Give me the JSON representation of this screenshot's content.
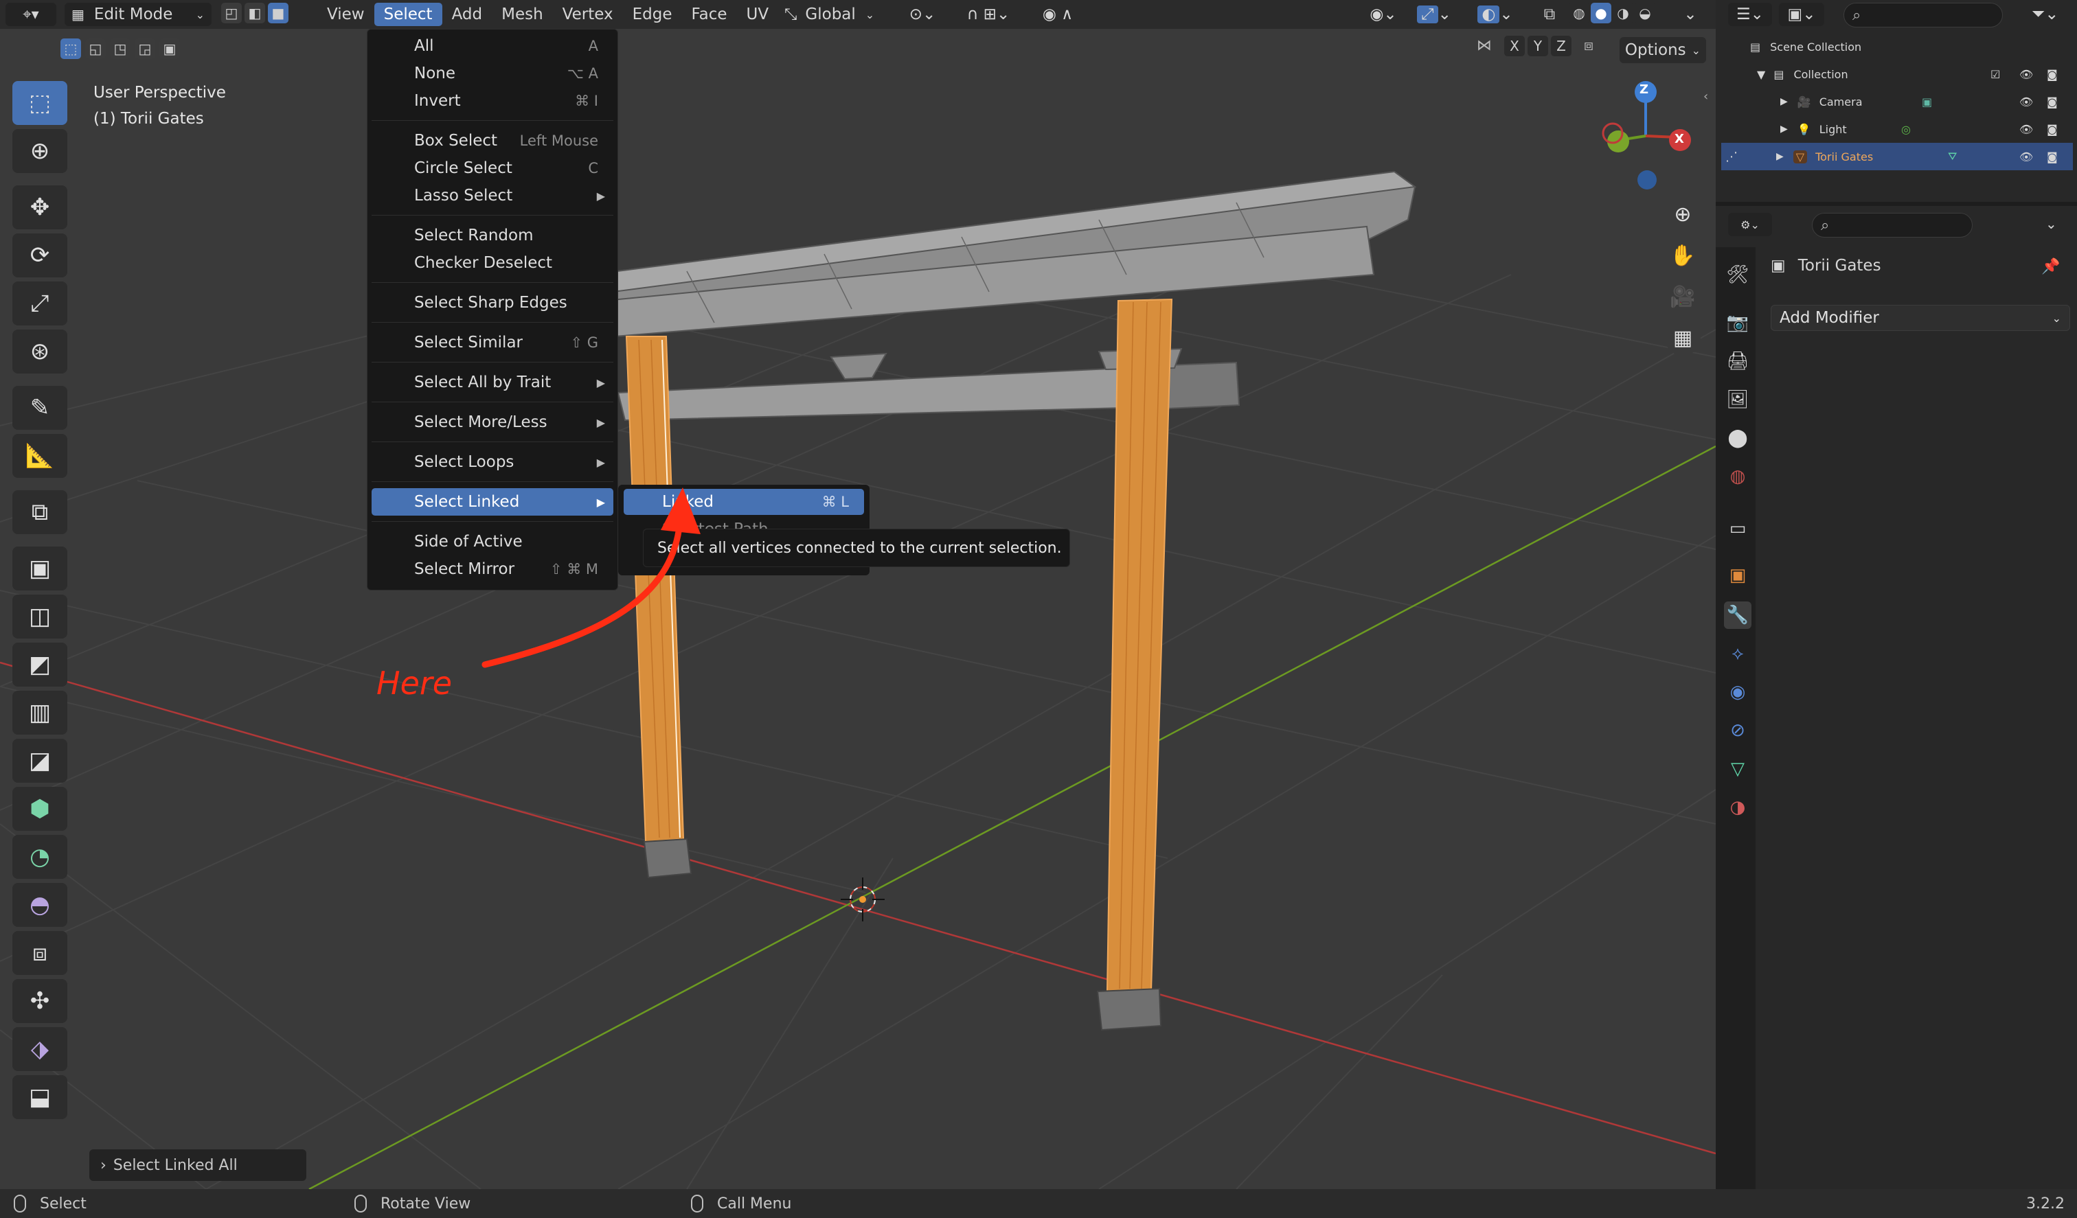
{
  "header": {
    "mode_label": "Edit Mode",
    "menus": [
      "View",
      "Select",
      "Add",
      "Mesh",
      "Vertex",
      "Edge",
      "Face",
      "UV"
    ],
    "active_menu": "Select",
    "orientation_label": "Global"
  },
  "viewport": {
    "perspective_label": "User Perspective",
    "object_label": "(1) Torii Gates",
    "options_label": "Options",
    "axis_x": "X",
    "axis_y": "Y",
    "axis_z": "Z",
    "gizmo_z": "Z",
    "gizmo_x": "X",
    "last_operator": "Select Linked All"
  },
  "select_menu": {
    "items": [
      {
        "label": "All",
        "shortcut": "A"
      },
      {
        "label": "None",
        "shortcut": "⌥ A"
      },
      {
        "label": "Invert",
        "shortcut": "⌘ I"
      },
      {
        "label": "Box Select",
        "shortcut": "Left Mouse"
      },
      {
        "label": "Circle Select",
        "shortcut": "C"
      },
      {
        "label": "Lasso Select",
        "shortcut": ""
      },
      {
        "label": "Select Random",
        "shortcut": ""
      },
      {
        "label": "Checker Deselect",
        "shortcut": ""
      },
      {
        "label": "Select Sharp Edges",
        "shortcut": ""
      },
      {
        "label": "Select Similar",
        "shortcut": "⇧ G"
      },
      {
        "label": "Select All by Trait",
        "shortcut": ""
      },
      {
        "label": "Select More/Less",
        "shortcut": ""
      },
      {
        "label": "Select Loops",
        "shortcut": ""
      },
      {
        "label": "Select Linked",
        "shortcut": ""
      },
      {
        "label": "Side of Active",
        "shortcut": ""
      },
      {
        "label": "Select Mirror",
        "shortcut": "⇧ ⌘ M"
      }
    ]
  },
  "submenu": {
    "linked_label": "Linked",
    "linked_shortcut": "⌘ L",
    "shortest_path_label": "Shortest Path",
    "tooltip": "Select all vertices connected to the current selection."
  },
  "annotation": {
    "text": "Here",
    "color": "#ff2d14"
  },
  "outliner": {
    "scene_collection": "Scene Collection",
    "collection": "Collection",
    "objects": [
      "Camera",
      "Light",
      "Torii Gates"
    ],
    "selected": "Torii Gates"
  },
  "properties": {
    "object_name": "Torii Gates",
    "add_modifier": "Add Modifier"
  },
  "statusbar": {
    "left_action": "Select",
    "middle_action": "Rotate View",
    "right_action": "Call Menu",
    "version": "3.2.2"
  },
  "colors": {
    "accent": "#4772b3",
    "selection_orange": "#e89a3c",
    "x_axis": "#c0392b",
    "y_axis": "#7aa52a"
  }
}
